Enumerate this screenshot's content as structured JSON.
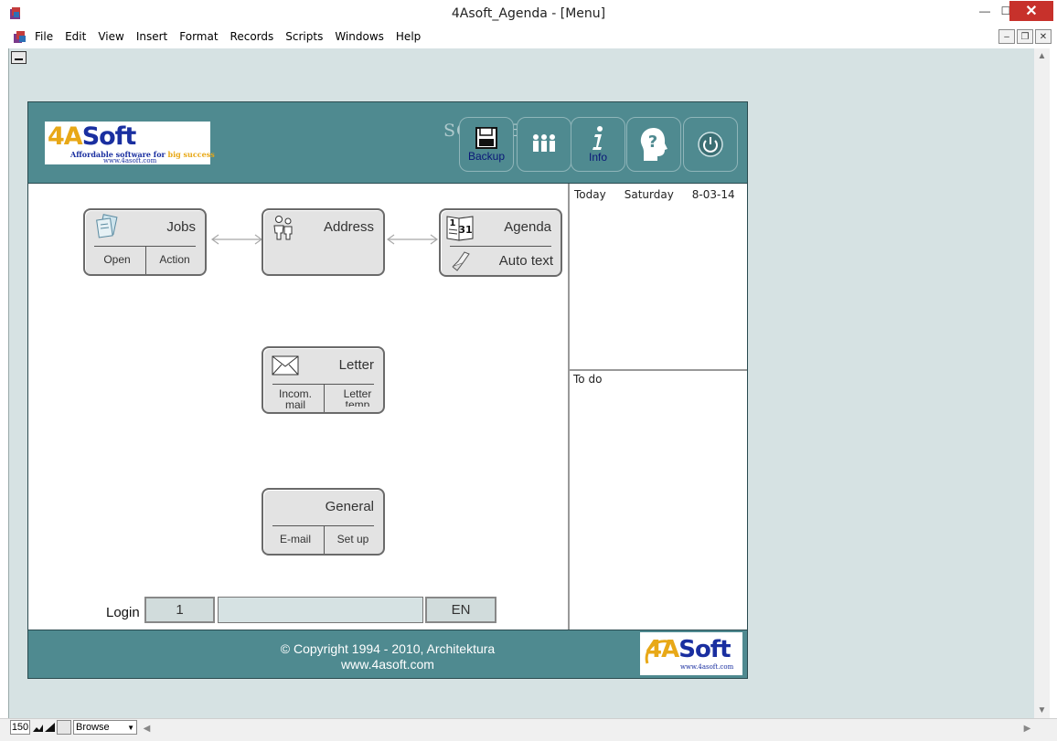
{
  "window": {
    "title": "4Asoft_Agenda - [Menu]",
    "minimize_glyph": "—",
    "maximize_glyph": "☐",
    "close_glyph": "✕"
  },
  "menubar": {
    "items": [
      "File",
      "Edit",
      "View",
      "Insert",
      "Format",
      "Records",
      "Scripts",
      "Windows",
      "Help"
    ],
    "mdi_minimize_glyph": "–",
    "mdi_restore_glyph": "❐",
    "mdi_close_glyph": "✕"
  },
  "header": {
    "logo": {
      "brand_four": "4A",
      "brand_rest": "Soft",
      "tagline_main": "Affordable software for ",
      "tagline_em": "big success",
      "url": "www.4asoft.com"
    },
    "buttons": [
      {
        "id": "backup",
        "label": "Backup",
        "icon": "floppy-disk-icon"
      },
      {
        "id": "users",
        "label": "",
        "icon": "users-icon"
      },
      {
        "id": "info",
        "label": "Info",
        "icon": "info-icon"
      },
      {
        "id": "help",
        "label": "",
        "icon": "help-head-icon"
      },
      {
        "id": "power",
        "label": "",
        "icon": "power-icon"
      }
    ],
    "watermark": "SOFTPEDIA"
  },
  "modules": {
    "jobs": {
      "title": "Jobs",
      "left": "Open",
      "right": "Action",
      "icon": "documents-icon"
    },
    "address": {
      "title": "Address",
      "icon": "people-icon"
    },
    "agenda": {
      "title": "Agenda",
      "bottom": "Auto text",
      "icon": "calendar-icon",
      "bottom_icon": "pen-icon",
      "calendar_day": "31",
      "calendar_month": "1"
    },
    "letter": {
      "title": "Letter",
      "left": "Incom. mail",
      "right": "Letter temp",
      "icon": "envelope-icon"
    },
    "general": {
      "title": "General",
      "left": "E-mail",
      "right": "Set up"
    }
  },
  "side": {
    "today_label": "Today",
    "today_day": "Saturday",
    "today_date": "8-03-14",
    "todo_label": "To do"
  },
  "login": {
    "label": "Login",
    "number": "1",
    "user_value": "",
    "language": "EN"
  },
  "footer": {
    "copyright": "©  Copyright 1994 - 2010, Architektura",
    "url": "www.4asoft.com",
    "logo_four": "4A",
    "logo_rest": "Soft",
    "logo_url": "www.4asoft.com"
  },
  "statusbar": {
    "zoom": "150",
    "mode": "Browse"
  },
  "colors": {
    "band": "#4f8a90",
    "background": "#d6e2e3",
    "brand_blue": "#1a2fa0",
    "brand_orange": "#e8a817"
  }
}
